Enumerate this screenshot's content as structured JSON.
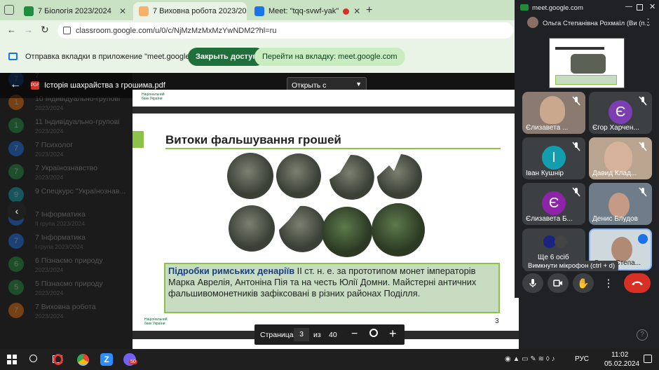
{
  "browser": {
    "tabs": [
      {
        "title": "7 Біологія 2023/2024",
        "icon_color": "#1e8e3e",
        "active": false
      },
      {
        "title": "7 Виховна робота 2023/20",
        "icon_color": "#f6b26b",
        "active": true
      },
      {
        "title": "Meet: \"tqq-svwf-yak\"",
        "icon_color": "#1a73e8",
        "active": false
      }
    ],
    "url": "classroom.google.com/u/0/c/NjMzMzMxMzYwNDM2?hl=ru"
  },
  "infobar": {
    "message": "Отправка вкладки в приложение \"meet.google.com\"...",
    "deny_label": "Закрыть доступ",
    "switch_label": "Перейти на вкладку: meet.google.com"
  },
  "pdf": {
    "file_name": "Історія шахрайства з грошима.pdf",
    "open_with_label": "Открыть с помощью...",
    "page_label": "Страница",
    "page": "3",
    "of_label": "из",
    "total": "40"
  },
  "slide": {
    "title": "Витоки фальшування грошей",
    "caption_bold": "Підробки римських денаріїв",
    "caption_text": " ІІ ст. н. е. за прототипом монет імператорів Марка Аврелія, Антоніна Пія та на честь Юлії Домни. Майстерні античних фальшивомонетників зафіксовані в різних районах Поділля.",
    "page_no": "3",
    "logo_text": "Національний банк України"
  },
  "classes": [
    {
      "title": "7",
      "sub": "2023/2024",
      "badge": "7",
      "color": "#1a73e8"
    },
    {
      "title": "10 Індивідуально-групові",
      "sub": "2023/2024",
      "badge": "1",
      "color": "#e8710a"
    },
    {
      "title": "11 Індивідуально-групові",
      "sub": "2023/2024",
      "badge": "1",
      "color": "#1e8e3e"
    },
    {
      "title": "7 Психолог",
      "sub": "2023/2024",
      "badge": "7",
      "color": "#1a73e8"
    },
    {
      "title": "7 Українознавство",
      "sub": "2023/2024",
      "badge": "7",
      "color": "#1e8e3e"
    },
    {
      "title": "9 Спецкурс \"Українознав...",
      "sub": "",
      "badge": "9",
      "color": "#129eaf"
    },
    {
      "title": "7 Інформатика",
      "sub": "ІІ група 2023/2024",
      "badge": "7",
      "color": "#1a73e8"
    },
    {
      "title": "7 Інформатика",
      "sub": "І група 2023/2024",
      "badge": "7",
      "color": "#1a73e8"
    },
    {
      "title": "6 Пізнаємо природу",
      "sub": "2023/2024",
      "badge": "6",
      "color": "#1e8e3e"
    },
    {
      "title": "5 Пізнаємо природу",
      "sub": "2023/2024",
      "badge": "5",
      "color": "#1e8e3e"
    },
    {
      "title": "7 Виховна робота",
      "sub": "2023/2024",
      "badge": "7",
      "color": "#e8710a"
    }
  ],
  "meet": {
    "domain": "meet.google.com",
    "presenter": "Ольга Степанівна Рохмаїл (Ви (п...",
    "participants": [
      {
        "name": "Єлизавета ...",
        "initial": "",
        "avatar_color": ""
      },
      {
        "name": "Єгор Харчен...",
        "initial": "Є",
        "avatar_color": "#7b3fb3"
      },
      {
        "name": "Іван Кушнір",
        "initial": "І",
        "avatar_color": "#129eaf"
      },
      {
        "name": "Давид Клад...",
        "initial": "",
        "avatar_color": ""
      },
      {
        "name": "Єлизавета Б...",
        "initial": "Є",
        "avatar_color": "#8e24aa"
      },
      {
        "name": "Денис Блудов",
        "initial": "",
        "avatar_color": ""
      }
    ],
    "more_label": "Ще 6 осіб",
    "self_name": "Ольга Степа...",
    "tooltip": "Вимкнути мікрофон (ctrl + d)"
  },
  "taskbar": {
    "time": "11:02",
    "date": "05.02.2024",
    "lang": "РУС",
    "badge": "50"
  }
}
